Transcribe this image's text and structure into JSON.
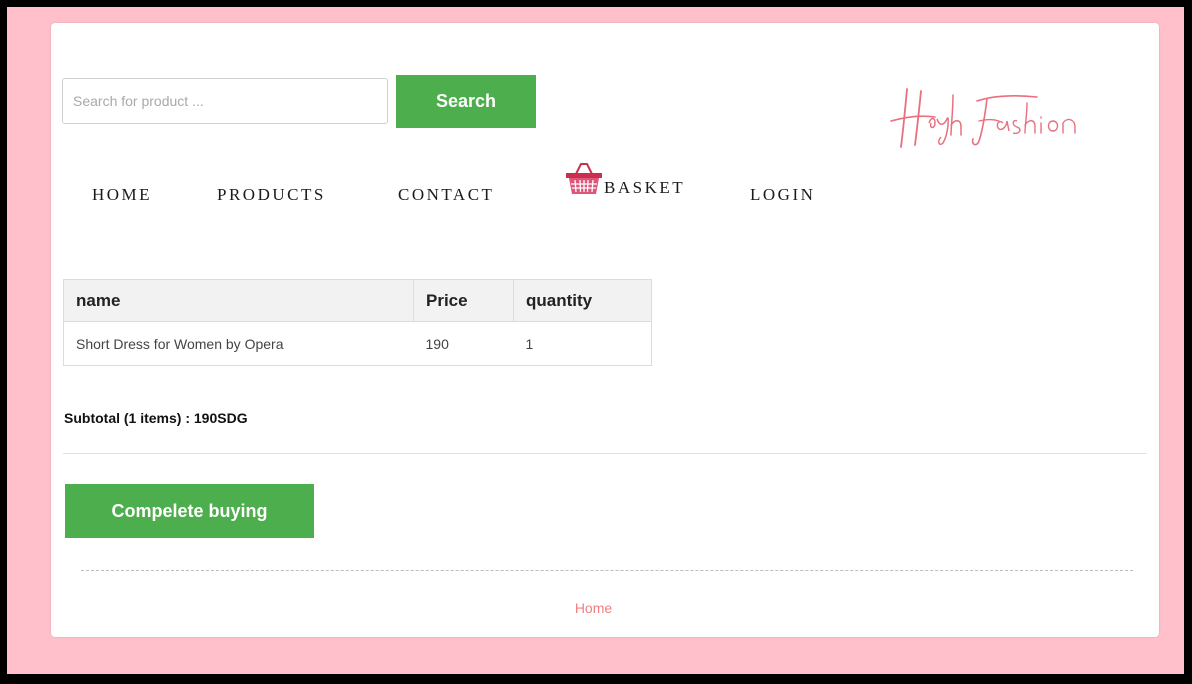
{
  "search": {
    "placeholder": "Search for product ...",
    "value": "",
    "button_label": "Search"
  },
  "brand": {
    "logo_text": "High Fashion",
    "logo_color": "#e8707e"
  },
  "nav": {
    "items": [
      {
        "label": "HOME"
      },
      {
        "label": "PRODUCTS"
      },
      {
        "label": "CONTACT"
      },
      {
        "label": "BASKET",
        "icon": "basket-icon"
      },
      {
        "label": "LOGIN"
      }
    ]
  },
  "cart": {
    "columns": [
      "name",
      "Price",
      "quantity"
    ],
    "rows": [
      {
        "name": "Short Dress for Women by Opera",
        "price": "190",
        "quantity": "1"
      }
    ],
    "subtotal": "Subtotal (1 items) : 190SDG"
  },
  "actions": {
    "complete_label": "Compelete buying"
  },
  "footer": {
    "link_label": "Home"
  },
  "colors": {
    "background": "#ffc0cb",
    "accent_green": "#4cae4c",
    "link_pink": "#f07f7f"
  }
}
